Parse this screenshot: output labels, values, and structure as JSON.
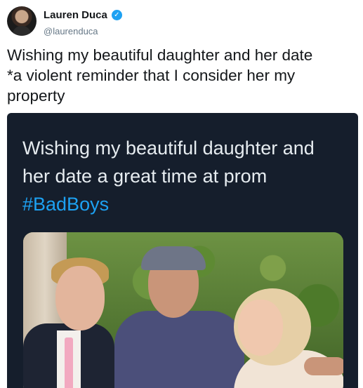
{
  "tweet": {
    "author": {
      "name": "Lauren Duca",
      "handle": "@laurenduca",
      "verified_icon": "verified-badge-icon"
    },
    "text": "Wishing my beautiful daughter and her date\n*a violent reminder that I consider her my\nproperty",
    "media": {
      "caption": "Wishing my beautiful daughter and her date a great time at prom",
      "hashtag": "#BadBoys"
    }
  },
  "colors": {
    "accent": "#1da1f2",
    "text": "#14171a",
    "muted": "#657786",
    "media_bg": "#151e2c"
  }
}
